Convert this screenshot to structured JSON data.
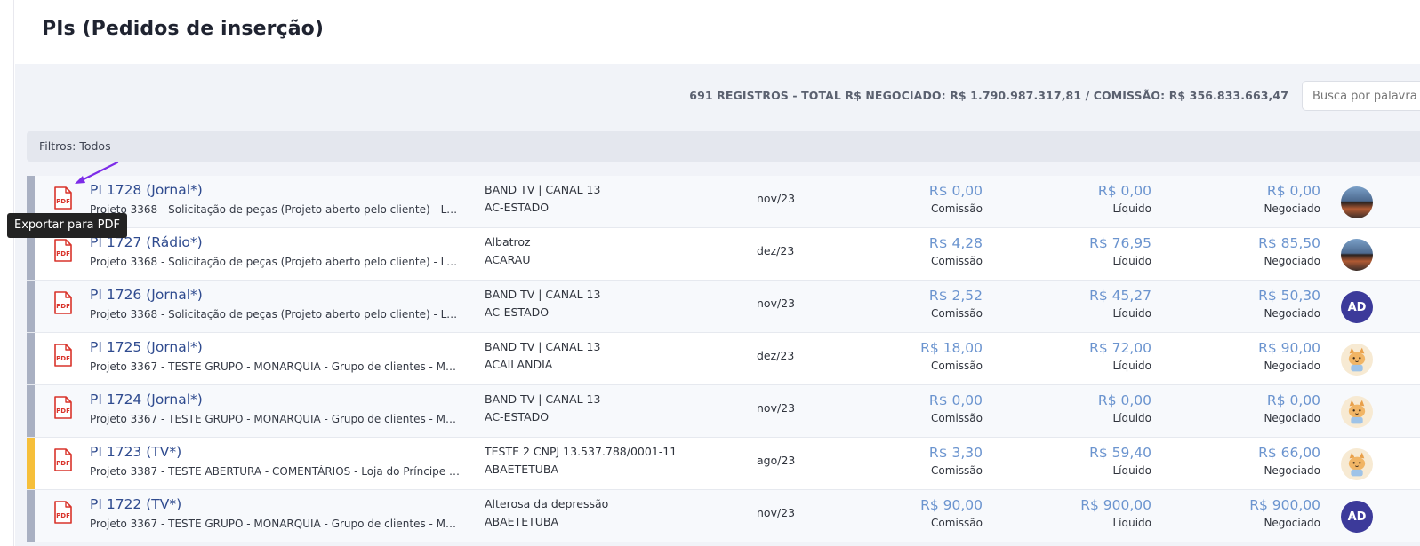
{
  "page": {
    "title": "PIs (Pedidos de inserção)"
  },
  "summary": "691 REGISTROS - TOTAL R$ NEGOCIADO: R$ 1.790.987.317,81 / COMISSÃO: R$ 356.833.663,47",
  "search": {
    "placeholder": "Busca por palavra"
  },
  "filters": {
    "label": "Filtros: Todos"
  },
  "tooltip": "Exportar para PDF",
  "colors": {
    "accent_link": "#2f4b8f",
    "money": "#6b94cf",
    "stripe_default": "#a9b0c2",
    "stripe_warning": "#f6bf3a",
    "pdf_icon": "#d9342b",
    "annotation_arrow": "#7d2ce8"
  },
  "rows": [
    {
      "title": "PI 1728 (Jornal*)",
      "desc": "Projeto 3368 - Solicitação de peças (Projeto aberto pelo cliente) - Loja do Príncipe",
      "vehicle": "BAND TV | CANAL 13",
      "location": "AC-ESTADO",
      "date": "nov/23",
      "commission": "R$ 0,00",
      "commission_label": "Comissão",
      "net": "R$ 0,00",
      "net_label": "Líquido",
      "negotiated": "R$ 0,00",
      "negotiated_label": "Negociado",
      "avatar": "photo",
      "avatar_text": "",
      "stripe": "default"
    },
    {
      "title": "PI 1727 (Rádio*)",
      "desc": "Projeto 3368 - Solicitação de peças (Projeto aberto pelo cliente) - Loja do Príncipe",
      "vehicle": "Albatroz",
      "location": "ACARAU",
      "date": "dez/23",
      "commission": "R$ 4,28",
      "commission_label": "Comissão",
      "net": "R$ 76,95",
      "net_label": "Líquido",
      "negotiated": "R$ 85,50",
      "negotiated_label": "Negociado",
      "avatar": "photo",
      "avatar_text": "",
      "stripe": "default"
    },
    {
      "title": "PI 1726 (Jornal*)",
      "desc": "Projeto 3368 - Solicitação de peças (Projeto aberto pelo cliente) - Loja do Príncipe",
      "vehicle": "BAND TV | CANAL 13",
      "location": "AC-ESTADO",
      "date": "nov/23",
      "commission": "R$ 2,52",
      "commission_label": "Comissão",
      "net": "R$ 45,27",
      "net_label": "Líquido",
      "negotiated": "R$ 50,30",
      "negotiated_label": "Negociado",
      "avatar": "ad",
      "avatar_text": "AD",
      "stripe": "default"
    },
    {
      "title": "PI 1725 (Jornal*)",
      "desc": "Projeto 3367 - TESTE GRUPO - MONARQUIA - Grupo de clientes - MONARQUIA",
      "vehicle": "BAND TV | CANAL 13",
      "location": "ACAILANDIA",
      "date": "dez/23",
      "commission": "R$ 18,00",
      "commission_label": "Comissão",
      "net": "R$ 72,00",
      "net_label": "Líquido",
      "negotiated": "R$ 90,00",
      "negotiated_label": "Negociado",
      "avatar": "cat",
      "avatar_text": "",
      "stripe": "default"
    },
    {
      "title": "PI 1724 (Jornal*)",
      "desc": "Projeto 3367 - TESTE GRUPO - MONARQUIA - Grupo de clientes - MONARQUIA",
      "vehicle": "BAND TV | CANAL 13",
      "location": "AC-ESTADO",
      "date": "nov/23",
      "commission": "R$ 0,00",
      "commission_label": "Comissão",
      "net": "R$ 0,00",
      "net_label": "Líquido",
      "negotiated": "R$ 0,00",
      "negotiated_label": "Negociado",
      "avatar": "cat",
      "avatar_text": "",
      "stripe": "default"
    },
    {
      "title": "PI 1723 (TV*)",
      "desc": "Projeto 3387 - TESTE ABERTURA - COMENTÁRIOS - Loja do Príncipe (anunciante)",
      "vehicle": "TESTE 2 CNPJ 13.537.788/0001-11",
      "location": "ABAETETUBA",
      "date": "ago/23",
      "commission": "R$ 3,30",
      "commission_label": "Comissão",
      "net": "R$ 59,40",
      "net_label": "Líquido",
      "negotiated": "R$ 66,00",
      "negotiated_label": "Negociado",
      "avatar": "cat",
      "avatar_text": "",
      "stripe": "warning"
    },
    {
      "title": "PI 1722 (TV*)",
      "desc": "Projeto 3367 - TESTE GRUPO - MONARQUIA - Grupo de clientes - MONARQUIA",
      "vehicle": "Alterosa da depressão",
      "location": "ABAETETUBA",
      "date": "nov/23",
      "commission": "R$ 90,00",
      "commission_label": "Comissão",
      "net": "R$ 900,00",
      "net_label": "Líquido",
      "negotiated": "R$ 900,00",
      "negotiated_label": "Negociado",
      "avatar": "ad",
      "avatar_text": "AD",
      "stripe": "default"
    }
  ]
}
